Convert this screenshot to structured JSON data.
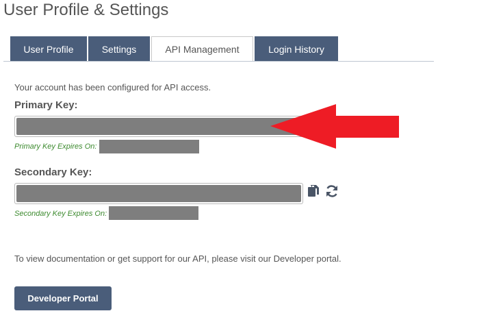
{
  "page": {
    "title": "User Profile & Settings"
  },
  "tabs": [
    {
      "label": "User Profile",
      "active": false
    },
    {
      "label": "Settings",
      "active": false
    },
    {
      "label": "API Management",
      "active": true
    },
    {
      "label": "Login History",
      "active": false
    }
  ],
  "api": {
    "intro": "Your account has been configured for API access.",
    "primary": {
      "label": "Primary Key:",
      "value": "",
      "expires_label": "Primary Key Expires On:",
      "expires_value": ""
    },
    "secondary": {
      "label": "Secondary Key:",
      "value": "",
      "expires_label": "Secondary Key Expires On:",
      "expires_value": ""
    },
    "docs_text": "To view documentation or get support for our API, please visit our Developer portal.",
    "portal_button": "Developer Portal"
  },
  "icons": {
    "copy": "copy-icon",
    "refresh": "refresh-icon",
    "annotation": "red-arrow-icon"
  },
  "colors": {
    "tab_bg": "#4a5d7a",
    "button_bg": "#4a5d7a",
    "expires_text": "#3c8a2e",
    "redaction": "#7e7e7e",
    "annotation_arrow": "#ee1c25"
  }
}
